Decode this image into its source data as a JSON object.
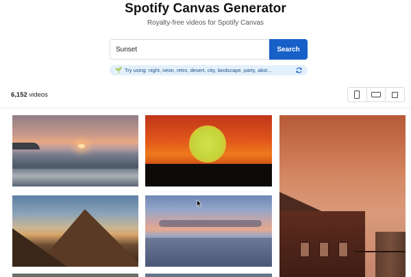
{
  "header": {
    "title": "Spotify Canvas Generator",
    "subtitle": "Royalty-free videos for Spotify Canvas"
  },
  "search": {
    "value": "Sunset",
    "placeholder": "",
    "button_label": "Search"
  },
  "suggestions": {
    "text": "Try using: night, neon, retro, desert, city, landscape, party, abst...",
    "icon": "sprout-icon",
    "refresh_icon": "refresh-icon"
  },
  "results": {
    "count": "6,152",
    "count_label": "videos"
  },
  "view_toggle": {
    "options": [
      "portrait-icon",
      "landscape-icon",
      "square-icon"
    ]
  },
  "colors": {
    "accent": "#1660c8",
    "suggest_bg": "#e3f0fb",
    "suggest_text": "#1c4f86"
  },
  "thumbnails": [
    {
      "name": "sunset-beach-waves"
    },
    {
      "name": "orange-sun-horizon"
    },
    {
      "name": "cabin-window-rain"
    },
    {
      "name": "mountain-sunset"
    },
    {
      "name": "ocean-clouds-dusk"
    }
  ]
}
